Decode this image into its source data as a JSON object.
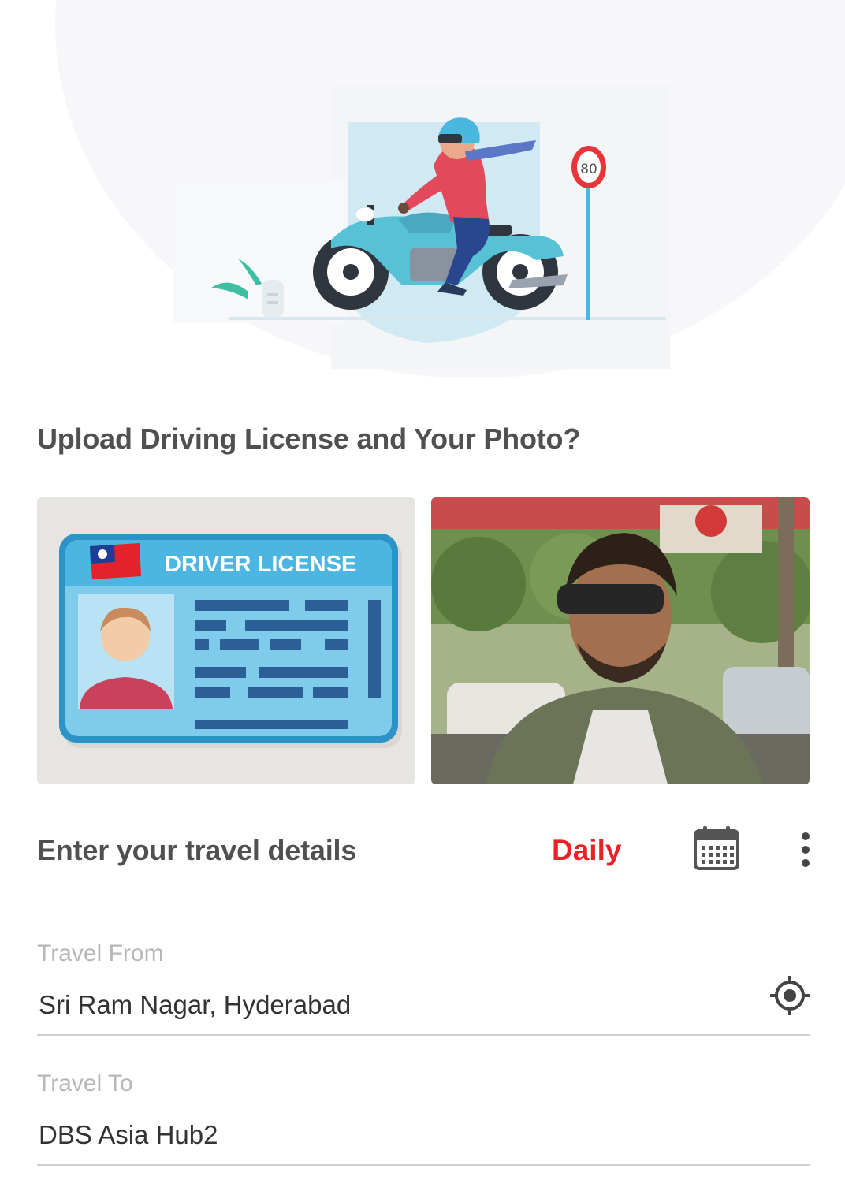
{
  "upload": {
    "title": "Upload Driving License and Your Photo?",
    "license_card_text": "DRIVER LICENSE"
  },
  "hero": {
    "speed_sign": "80"
  },
  "travel": {
    "title": "Enter your travel details",
    "frequency": "Daily",
    "from_label": "Travel From",
    "from_value": "Sri Ram Nagar, Hyderabad",
    "to_label": "Travel To",
    "to_value": "DBS Asia Hub2"
  },
  "icons": {
    "calendar": "calendar-icon",
    "more": "more-vertical-icon",
    "locate": "gps-locate-icon"
  },
  "colors": {
    "accent": "#ea2127",
    "title": "#505050",
    "label": "#b7b7b7"
  }
}
